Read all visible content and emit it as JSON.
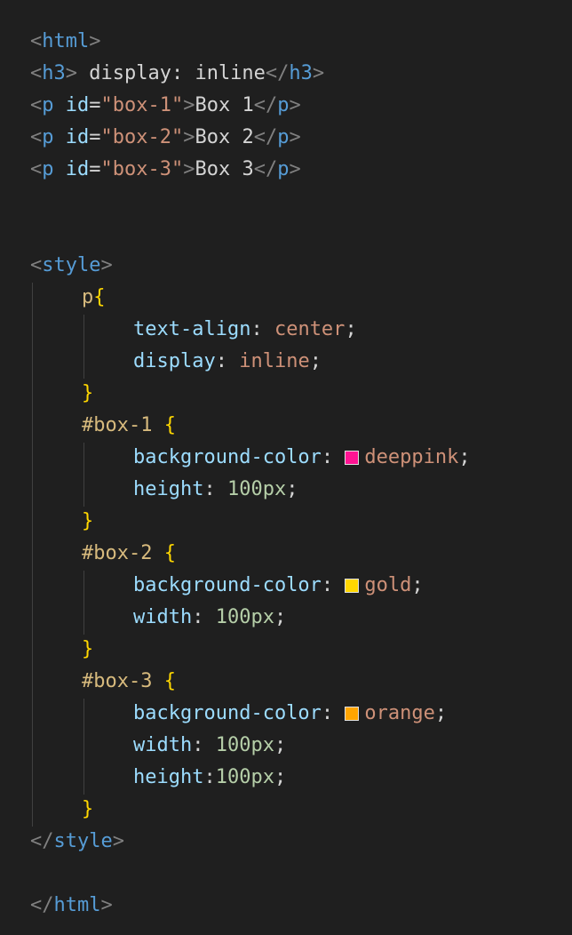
{
  "code": {
    "html_tag": "html",
    "h3_tag": "h3",
    "h3_text": " display: inline",
    "p_tag": "p",
    "id_attr": "id",
    "box1_id": "\"box-1\"",
    "box2_id": "\"box-2\"",
    "box3_id": "\"box-3\"",
    "box1_text": "Box 1",
    "box2_text": "Box 2",
    "box3_text": "Box 3",
    "style_tag": "style",
    "p_selector": "p",
    "text_align_prop": "text-align",
    "text_align_val": "center",
    "display_prop": "display",
    "display_val": "inline",
    "box1_selector": "#box-1 ",
    "box2_selector": "#box-2 ",
    "box3_selector": "#box-3 ",
    "bg_prop": "background-color",
    "height_prop": "height",
    "width_prop": "width",
    "box1_bg": "deeppink",
    "box2_bg": "gold",
    "box3_bg": "orange",
    "px100": "100px"
  },
  "colors": {
    "deeppink": "#ff1493",
    "gold": "#ffd700",
    "orange": "#ffa500"
  }
}
